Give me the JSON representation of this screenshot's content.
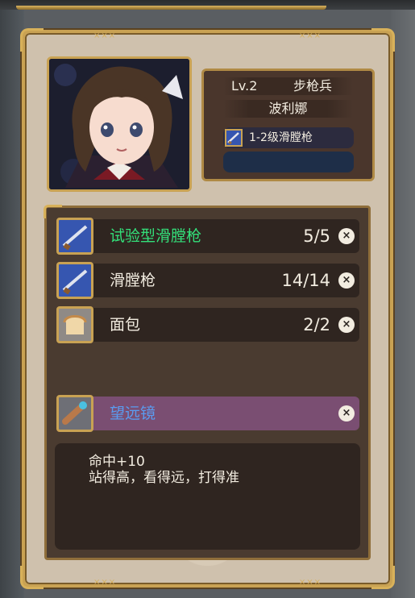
{
  "character": {
    "level": "Lv.2",
    "class": "步枪兵",
    "name": "波利娜",
    "weapon": "1-2级滑膛枪"
  },
  "inventory": [
    {
      "name": "试验型滑膛枪",
      "count": "5/5",
      "icon": "musket-icon",
      "name_color": "#33e07a"
    },
    {
      "name": "滑膛枪",
      "count": "14/14",
      "icon": "musket-icon",
      "name_color": "#f2ece0"
    },
    {
      "name": "面包",
      "count": "2/2",
      "icon": "bread-icon",
      "name_color": "#f2ece0"
    }
  ],
  "accessory": {
    "name": "望远镜",
    "icon": "telescope-icon",
    "name_color": "#5a9cf0"
  },
  "description": {
    "line1": "命中+10",
    "line2": "站得高，看得远，打得准"
  },
  "ui": {
    "close_symbol": "×",
    "ornament": "×××"
  },
  "colors": {
    "frame_gold": "#c9a253",
    "panel_brown": "#4a3b30",
    "accessory_bar": "#7a4e72"
  }
}
